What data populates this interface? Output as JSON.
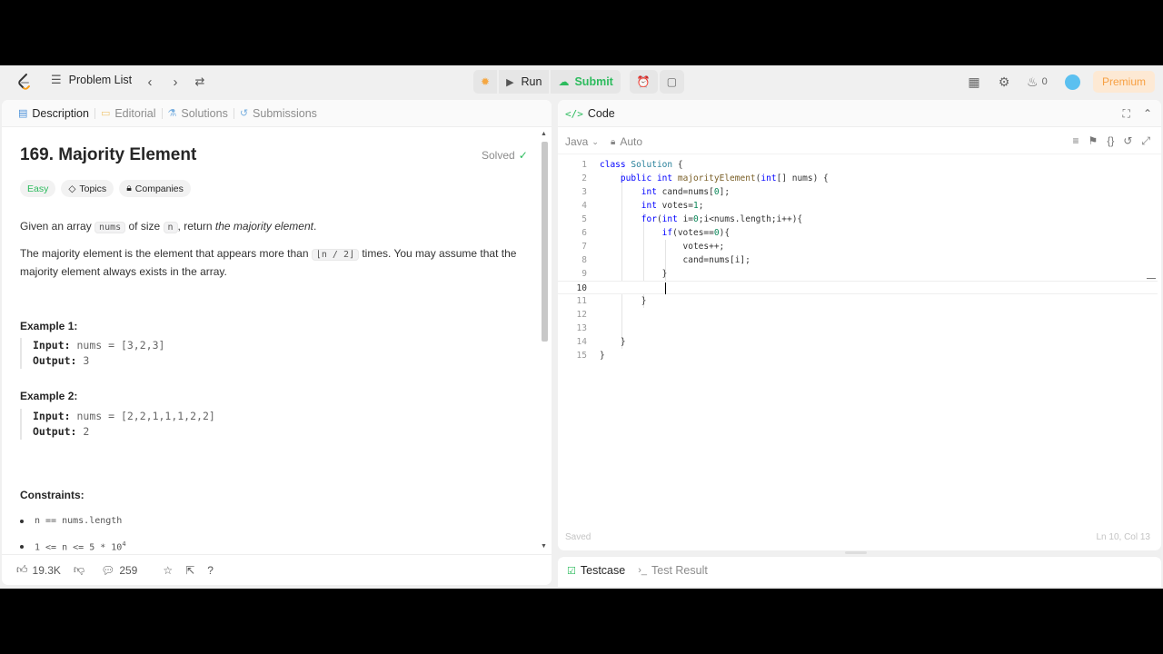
{
  "nav": {
    "problem_list": "Problem List",
    "run": "Run",
    "submit": "Submit",
    "streak_count": "0",
    "premium": "Premium"
  },
  "left": {
    "tabs": [
      "Description",
      "Editorial",
      "Solutions",
      "Submissions"
    ],
    "title": "169. Majority Element",
    "solved": "Solved",
    "badges": {
      "difficulty": "Easy",
      "topics": "Topics",
      "companies": "Companies"
    },
    "p1": {
      "a": "Given an array",
      "code1": "nums",
      "b": "of size",
      "code2": "n",
      "c": ", return",
      "em": "the majority element",
      "d": "."
    },
    "p2": {
      "a": "The majority element is the element that appears more than",
      "code": "⌊n / 2⌋",
      "b": "times. You may assume that the majority element always exists in the array."
    },
    "example1": {
      "heading": "Example 1:",
      "input_label": "Input:",
      "input": "nums = [3,2,3]",
      "output_label": "Output:",
      "output": "3"
    },
    "example2": {
      "heading": "Example 2:",
      "input_label": "Input:",
      "input": "nums = [2,2,1,1,1,2,2]",
      "output_label": "Output:",
      "output": "2"
    },
    "constraints_heading": "Constraints:",
    "constraints": [
      "n == nums.length",
      "1 <= n <= 5 * 10"
    ],
    "constraint_exp": "4",
    "footer": {
      "likes": "19.3K",
      "comments": "259"
    }
  },
  "right": {
    "code_title": "Code",
    "language": "Java",
    "auto": "Auto",
    "saved": "Saved",
    "cursor_pos": "Ln 10, Col 13",
    "code_lines": [
      "class Solution {",
      "    public int majorityElement(int[] nums) {",
      "        int cand=nums[0];",
      "        int votes=1;",
      "        for(int i=0;i<nums.length;i++){",
      "            if(votes==0){",
      "                votes++;",
      "                cand=nums[i];",
      "            }",
      "            ",
      "        }",
      "",
      "",
      "    }",
      "}"
    ],
    "active_line": 10
  },
  "bottom": {
    "testcase": "Testcase",
    "test_result": "Test Result"
  }
}
